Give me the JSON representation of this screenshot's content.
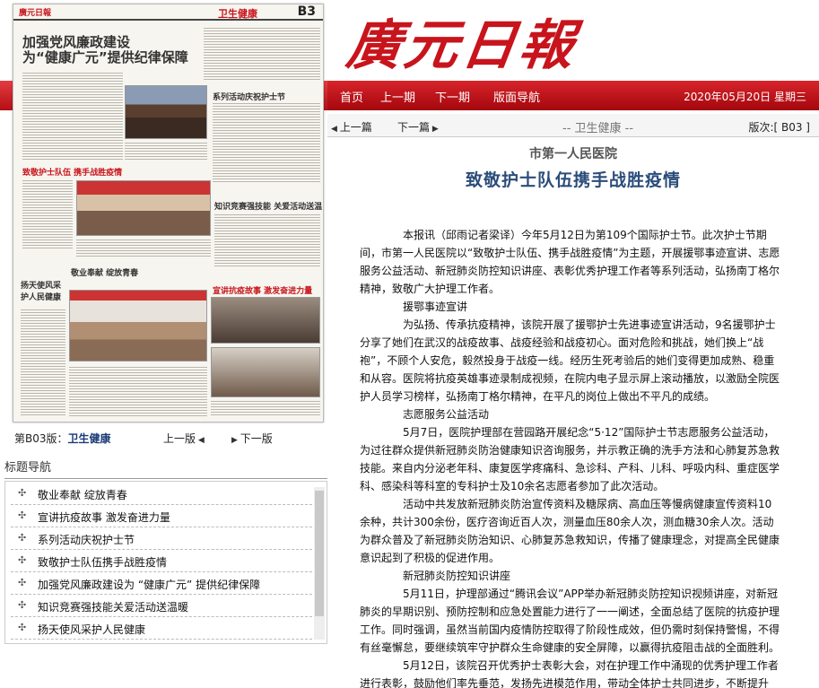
{
  "masthead": {
    "logo": "廣元日報"
  },
  "nav": {
    "items": [
      "首页",
      "上一期",
      "下一期",
      "版面导航"
    ],
    "date": "2020年05月20日 星期三"
  },
  "paper_thumb": {
    "logo": "廣元日報",
    "section": "卫生健康",
    "page_number": "B3",
    "headline_1": "加强党风廉政建设",
    "headline_2": "为“健康广元”提供纪律保障",
    "small_heads": [
      "致敬护士队伍  携手战胜疫情",
      "系列活动庆祝护士节",
      "知识竞赛强技能  关爱活动送温暖",
      "敬业奉献  绽放青春",
      "宣讲抗疫故事  激发奋进力量",
      "扬天使风采护人民健康"
    ]
  },
  "page_label": {
    "prefix": "第B03版：",
    "name": "卫生健康"
  },
  "page_nav": {
    "prev": "上一版",
    "next": "下一版"
  },
  "title_nav": {
    "header": "标题导航",
    "items": [
      "敬业奉献  绽放青春",
      "宣讲抗疫故事  激发奋进力量",
      "系列活动庆祝护士节",
      "致敬护士队伍携手战胜疫情",
      "加强党风廉政建设为 “健康广元” 提供纪律保障",
      "知识竞赛强技能关爱活动送温暖",
      "扬天使风采护人民健康"
    ]
  },
  "article_bar": {
    "prev": "上一篇",
    "next": "下一篇",
    "section": "-- 卫生健康 --",
    "page": "版次:[ B03 ]"
  },
  "article": {
    "subtitle": "市第一人民医院",
    "title": "致敬护士队伍携手战胜疫情",
    "paragraphs": [
      "本报讯（邱雨记者梁译）今年5月12日为第109个国际护士节。此次护士节期间，市第一人民医院以“致敬护士队伍、携手战胜疫情”为主题，开展援鄂事迹宣讲、志愿服务公益活动、新冠肺炎防控知识讲座、表彰优秀护理工作者等系列活动，弘扬南丁格尔精神，致敬广大护理工作者。",
      "援鄂事迹宣讲",
      "为弘扬、传承抗疫精神，该院开展了援鄂护士先进事迹宣讲活动，9名援鄂护士分享了她们在武汉的战疫故事、战疫经验和战疫初心。面对危险和挑战，她们换上“战袍”，不顾个人安危，毅然投身于战疫一线。经历生死考验后的她们变得更加成熟、稳重和从容。医院将抗疫英雄事迹录制成视频，在院内电子显示屏上滚动播放，以激励全院医护人员学习榜样，弘扬南丁格尔精神，在平凡的岗位上做出不平凡的成绩。",
      "志愿服务公益活动",
      "5月7日，医院护理部在营园路开展纪念“5·12”国际护士节志愿服务公益活动，为过往群众提供新冠肺炎防治健康知识咨询服务，并示教正确的洗手方法和心肺复苏急救技能。来自内分泌老年科、康复医学疼痛科、急诊科、产科、儿科、呼吸内科、重症医学科、感染科等科室的专科护士及10余名志愿者参加了此次活动。",
      "活动中共发放新冠肺炎防治宣传资料及糖尿病、高血压等慢病健康宣传资料10余种，共计300余份，医疗咨询近百人次，测量血压80余人次，测血糖30余人次。活动为群众普及了新冠肺炎防治知识、心肺复苏急救知识，传播了健康理念，对提高全民健康意识起到了积极的促进作用。",
      "新冠肺炎防控知识讲座",
      "5月11日，护理部通过“腾讯会议”APP举办新冠肺炎防控知识视频讲座，对新冠肺炎的早期识别、预防控制和应急处置能力进行了一一阐述，全面总结了医院的抗疫护理工作。同时强调，虽然当前国内疫情防控取得了阶段性成效，但仍需时刻保持警惕，不得有丝毫懈怠，要继续筑牢守护群众生命健康的安全屏障，以赢得抗疫阻击战的全面胜利。",
      "5月12日，该院召开优秀护士表彰大会，对在护理工作中涌现的优秀护理工作者进行表彰，鼓励他们率先垂范，发扬先进模范作用，带动全体护士共同进步，不断提升"
    ]
  },
  "colors": {
    "brand_red": "#c8141c",
    "title_blue": "#2b4d7a"
  }
}
